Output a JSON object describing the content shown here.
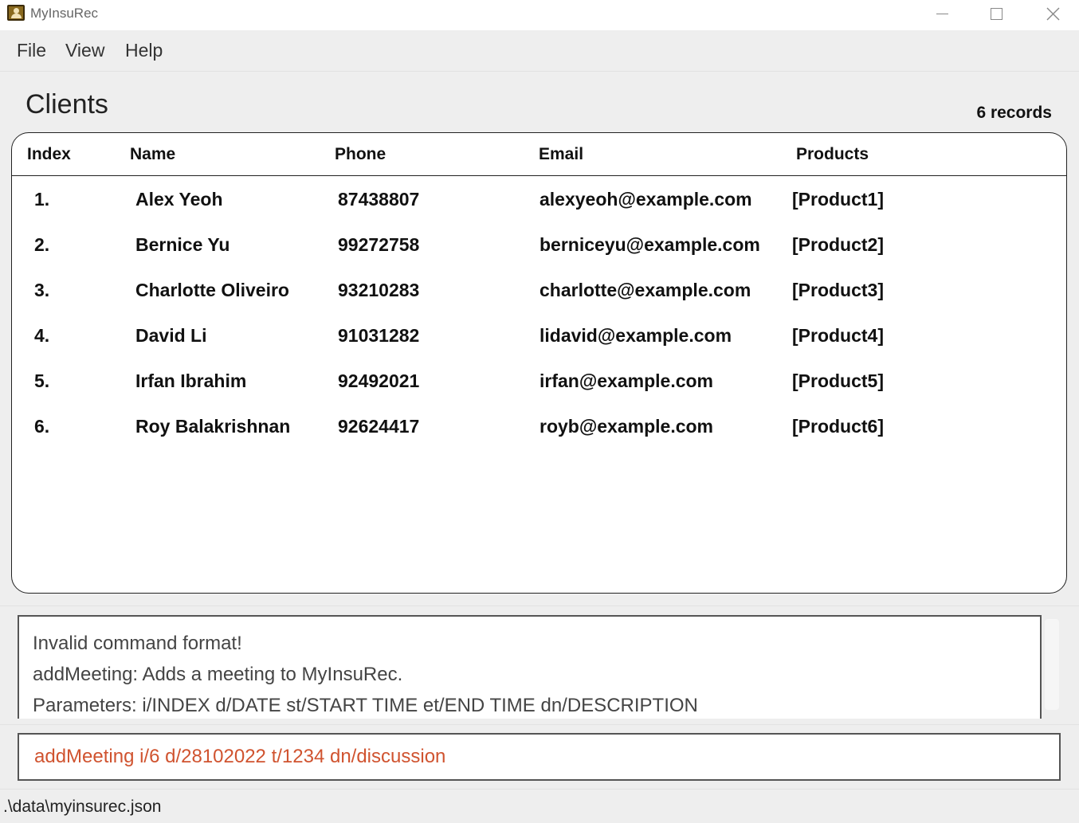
{
  "window": {
    "title": "MyInsuRec"
  },
  "menu": {
    "items": [
      "File",
      "View",
      "Help"
    ]
  },
  "main": {
    "title": "Clients",
    "record_count": "6 records"
  },
  "table": {
    "columns": [
      "Index",
      "Name",
      "Phone",
      "Email",
      "Products"
    ],
    "rows": [
      {
        "index": "1.",
        "name": "Alex Yeoh",
        "phone": "87438807",
        "email": "alexyeoh@example.com",
        "products": "[Product1]"
      },
      {
        "index": "2.",
        "name": "Bernice Yu",
        "phone": "99272758",
        "email": "berniceyu@example.com",
        "products": "[Product2]"
      },
      {
        "index": "3.",
        "name": "Charlotte Oliveiro",
        "phone": "93210283",
        "email": "charlotte@example.com",
        "products": "[Product3]"
      },
      {
        "index": "4.",
        "name": "David Li",
        "phone": "91031282",
        "email": "lidavid@example.com",
        "products": "[Product4]"
      },
      {
        "index": "5.",
        "name": "Irfan Ibrahim",
        "phone": "92492021",
        "email": "irfan@example.com",
        "products": "[Product5]"
      },
      {
        "index": "6.",
        "name": "Roy Balakrishnan",
        "phone": "92624417",
        "email": "royb@example.com",
        "products": "[Product6]"
      }
    ]
  },
  "result": {
    "lines": [
      "Invalid command format!",
      "addMeeting: Adds a meeting to MyInsuRec.",
      "Parameters: i/INDEX d/DATE st/START TIME et/END TIME dn/DESCRIPTION"
    ]
  },
  "command": {
    "value": "addMeeting i/6 d/28102022 t/1234 dn/discussion",
    "text_color": "#d0532f"
  },
  "status": {
    "path": ".\\data\\myinsurec.json"
  },
  "icons": {
    "app": "app-contact-icon",
    "minimize": "minimize-icon",
    "maximize": "maximize-icon",
    "close": "close-icon"
  }
}
